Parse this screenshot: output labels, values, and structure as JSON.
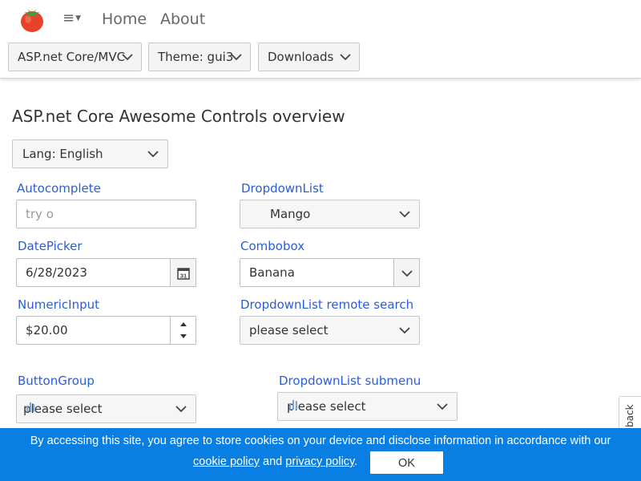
{
  "header": {
    "logo": "tomato-logo",
    "menu_icon": "hamburger-menu-icon",
    "nav": {
      "home": "Home",
      "about": "About"
    },
    "dropdowns": {
      "framework": "ASP.net Core/MVC",
      "theme": "Theme: gui3",
      "downloads": "Downloads"
    }
  },
  "main": {
    "title": "ASP.net Core Awesome Controls overview",
    "lang_select": "Lang: English",
    "fields": {
      "autocomplete": {
        "label": "Autocomplete",
        "value": "try o"
      },
      "dropdownlist": {
        "label": "DropdownList",
        "value": "Mango"
      },
      "datepicker": {
        "label": "DatePicker",
        "value": "6/28/2023",
        "icon_text": "31"
      },
      "combobox": {
        "label": "Combobox",
        "value": "Banana"
      },
      "numericinput": {
        "label": "NumericInput",
        "value": "$20.00"
      },
      "dropdown_remote": {
        "label": "DropdownList remote search",
        "value": "please select"
      },
      "buttongroup": {
        "label": "ButtonGroup",
        "value": "please select"
      },
      "dropdown_submenu": {
        "label": "DropdownList submenu",
        "value": "please select"
      }
    }
  },
  "cookie_bar": {
    "text_line1": "By accessing this site, you agree to store cookies on your device and disclose information in accordance with our",
    "cookie_policy": "cookie policy",
    "and": "and",
    "privacy_policy": "privacy policy",
    "period": ".",
    "ok": "OK",
    "background": "#0a7fe3"
  },
  "feedback_tab": "feedback",
  "colors": {
    "label_blue": "#2a5ed6",
    "logo_red": "#e8432a",
    "logo_green": "#3aa33a"
  }
}
